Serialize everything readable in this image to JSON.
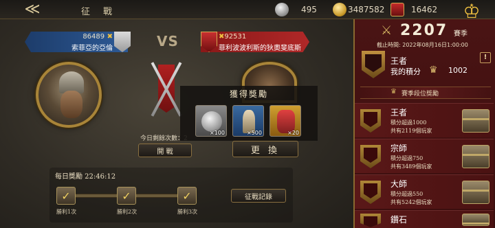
{
  "header": {
    "back_icon": "back-arrow-icon",
    "title": "征　戰",
    "silver": "495",
    "gold": "3487582",
    "badge_value": "16462"
  },
  "player_left": {
    "score": "86489",
    "name": "索菲亞的亞倫"
  },
  "vs_label": "VS",
  "player_right": {
    "score": "92531",
    "name": "菲利波波利斯的狄奧斐底斯"
  },
  "battle": {
    "remaining": "今日剩餘次數：2",
    "battle_button": "開 戰",
    "change_button": "更 換"
  },
  "reward_popup": {
    "title": "獲得獎勵",
    "items": [
      {
        "icon": "silver-coin-icon",
        "qty": "×100"
      },
      {
        "icon": "soldier-card-icon",
        "qty": "×500"
      },
      {
        "icon": "knight-card-icon",
        "qty": "×20"
      }
    ]
  },
  "daily": {
    "title": "每日獎勵 22:46:12",
    "chests": [
      {
        "label": "勝利1次"
      },
      {
        "label": "勝利2次"
      },
      {
        "label": "勝利3次"
      }
    ],
    "record_button": "征戰記錄"
  },
  "season": {
    "points": "2207",
    "label": "賽季",
    "deadline": "截止時間: 2022年08月16日1:00:00",
    "current_rank": "王者",
    "my_points_label": "我的積分",
    "my_points": "1002",
    "info_label": "!",
    "section_title": "賽季段位獎勵",
    "tiers": [
      {
        "name": "王者",
        "req": "積分超過1000",
        "count": "共有2119個玩家"
      },
      {
        "name": "宗師",
        "req": "積分超過750",
        "count": "共有3489個玩家"
      },
      {
        "name": "大師",
        "req": "積分超過550",
        "count": "共有5242個玩家"
      },
      {
        "name": "鑽石",
        "req": "",
        "count": ""
      }
    ]
  },
  "colors": {
    "sidebar": "#4a1414",
    "accent_gold": "#c8a050",
    "blue_banner": "#2d5a96",
    "red_banner": "#b02828"
  }
}
